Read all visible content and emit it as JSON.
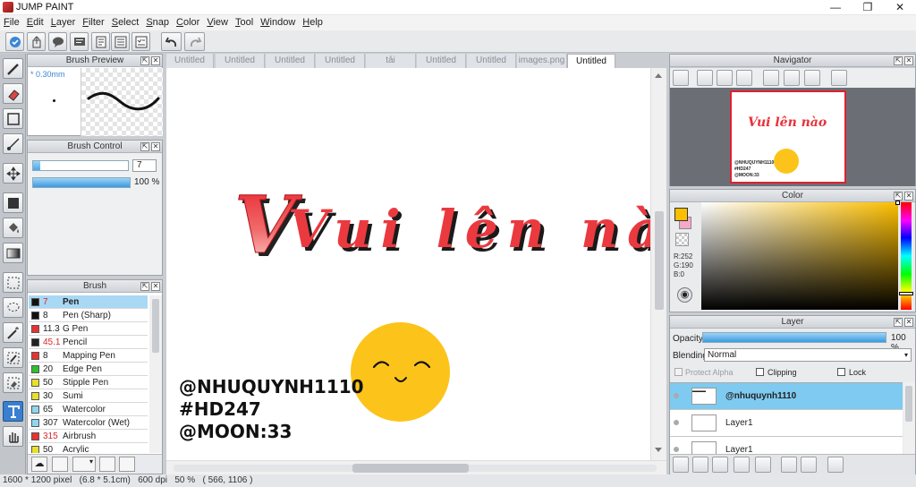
{
  "app": {
    "title": "JUMP PAINT"
  },
  "menu": [
    "File",
    "Edit",
    "Layer",
    "Filter",
    "Select",
    "Snap",
    "Color",
    "View",
    "Tool",
    "Window",
    "Help"
  ],
  "tabs": [
    {
      "label": "Untitled"
    },
    {
      "label": "Untitled"
    },
    {
      "label": "Untitled"
    },
    {
      "label": "Untitled"
    },
    {
      "label": "tải xuống.jpg"
    },
    {
      "label": "Untitled"
    },
    {
      "label": "Untitled"
    },
    {
      "label": "images.png"
    },
    {
      "label": "Untitled",
      "active": true
    }
  ],
  "brush_preview": {
    "title": "Brush Preview",
    "size_label": "* 0.30mm"
  },
  "brush_control": {
    "title": "Brush Control",
    "size_value": "7",
    "opacity_value": "100 %",
    "opacity_fill": 1.0,
    "size_fill": 0.08
  },
  "brush": {
    "title": "Brush",
    "items": [
      {
        "size": "7",
        "name": "Pen",
        "color": "#111111",
        "size_color": "#d9262b",
        "selected": true
      },
      {
        "size": "8",
        "name": "Pen (Sharp)",
        "color": "#111111",
        "size_color": "#222222"
      },
      {
        "size": "11.3",
        "name": "G Pen",
        "color": "#e83232",
        "size_color": "#222222"
      },
      {
        "size": "45.1",
        "name": "Pencil",
        "color": "#222222",
        "size_color": "#d9262b"
      },
      {
        "size": "8",
        "name": "Mapping Pen",
        "color": "#e83232",
        "size_color": "#222222"
      },
      {
        "size": "20",
        "name": "Edge Pen",
        "color": "#2fbf2f",
        "size_color": "#222222"
      },
      {
        "size": "50",
        "name": "Stipple Pen",
        "color": "#e8e02a",
        "size_color": "#222222"
      },
      {
        "size": "30",
        "name": "Sumi",
        "color": "#e8e02a",
        "size_color": "#222222"
      },
      {
        "size": "65",
        "name": "Watercolor",
        "color": "#8fd6f0",
        "size_color": "#222222"
      },
      {
        "size": "307",
        "name": "Watercolor (Wet)",
        "color": "#8fd6f0",
        "size_color": "#222222"
      },
      {
        "size": "315",
        "name": "Airbrush",
        "color": "#e83232",
        "size_color": "#d9262b"
      },
      {
        "size": "50",
        "name": "Acrylic",
        "color": "#e8e02a",
        "size_color": "#222222"
      }
    ]
  },
  "canvas": {
    "title_text": "Vui lên nào",
    "line1": "@NHUQUYNH1110",
    "line2": "#HD247",
    "line3": "@MOON:33"
  },
  "navigator": {
    "title": "Navigator",
    "thumb_title": "Vui lên nào",
    "thumb_line1": "@NHUQUYNH1110",
    "thumb_line2": "#HD247",
    "thumb_line3": "@MOON:33"
  },
  "color": {
    "title": "Color",
    "r": "R:252",
    "g": "G:190",
    "b": "B:0",
    "fg": "#fcbe00",
    "bg": "#f7a8c8"
  },
  "layer": {
    "title": "Layer",
    "opacity_label": "Opacity",
    "opacity_value": "100 %",
    "opacity_fill": 1.0,
    "blending_label": "Blending",
    "blending_value": "Normal",
    "protect_alpha": "Protect Alpha",
    "clipping": "Clipping",
    "lock": "Lock",
    "items": [
      {
        "name": "@nhuquynh1110",
        "selected": true
      },
      {
        "name": "Layer1"
      },
      {
        "name": "Layer1"
      }
    ]
  },
  "status": {
    "text": "1600 * 1200 pixel   (6.8 * 5.1cm)   600 dpi   50 %   ( 566, 1106 )"
  }
}
